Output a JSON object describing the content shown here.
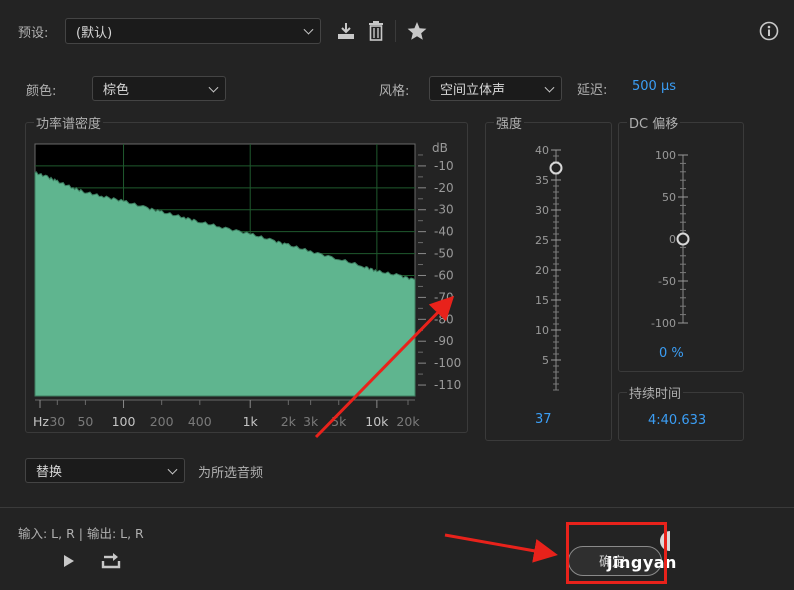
{
  "preset": {
    "label": "预设:",
    "value": "(默认)",
    "icons": [
      "download-icon",
      "trash-icon",
      "star-icon",
      "info-icon"
    ]
  },
  "color": {
    "label": "颜色:",
    "value": "棕色"
  },
  "style": {
    "label": "风格:",
    "value": "空间立体声"
  },
  "delay": {
    "label": "延迟:",
    "value": "500 µs"
  },
  "psd": {
    "title": "功率谱密度",
    "db_unit": "dB",
    "db_ticks": [
      "-10",
      "-20",
      "-30",
      "-40",
      "-50",
      "-60",
      "-70",
      "-80",
      "-90",
      "-100",
      "-110"
    ],
    "freq_ticks_major": [
      "Hz",
      "100",
      "1k",
      "10k"
    ],
    "freq_ticks_minor": [
      "30",
      "50",
      "200",
      "400",
      "2k",
      "3k",
      "5k",
      "20k"
    ]
  },
  "chart_data": {
    "type": "area",
    "xscale": "log",
    "x": [
      20,
      25,
      30,
      40,
      50,
      70,
      100,
      150,
      200,
      300,
      400,
      600,
      1000,
      1500,
      2000,
      3000,
      5000,
      8000,
      10000,
      15000,
      20000
    ],
    "y": [
      -13,
      -15,
      -17,
      -20,
      -22,
      -24,
      -26,
      -29,
      -31,
      -33.5,
      -35.5,
      -38,
      -41,
      -44,
      -46,
      -49,
      -52.5,
      -56,
      -58,
      -60,
      -62
    ],
    "xlim": [
      20,
      20000
    ],
    "ylim": [
      -115,
      0
    ],
    "ylabel": "dB",
    "fill": "#5fb58f",
    "grid": true,
    "grid_color": "#1f5a2e",
    "background": "#000000"
  },
  "intensity": {
    "title": "强度",
    "ticks": [
      "40",
      "35",
      "30",
      "25",
      "20",
      "15",
      "10",
      "5"
    ],
    "value": "37",
    "level": 37,
    "max": 40
  },
  "dc_offset": {
    "title": "DC 偏移",
    "ticks": [
      "100",
      "50",
      "0",
      "-50",
      "-100"
    ],
    "value": "0 %",
    "level": 0
  },
  "duration": {
    "title": "持续时间",
    "value": "4:40.633"
  },
  "mode": {
    "value": "替换",
    "suffix": "为所选音频"
  },
  "io": {
    "text": "输入: L, R | 输出: L, R"
  },
  "ok_button": {
    "label": "确定",
    "watermark": "jingyan"
  },
  "colors": {
    "accent": "#3b9ef5",
    "annotation": "#e8221b",
    "spectrum_fill": "#5fb58f"
  }
}
